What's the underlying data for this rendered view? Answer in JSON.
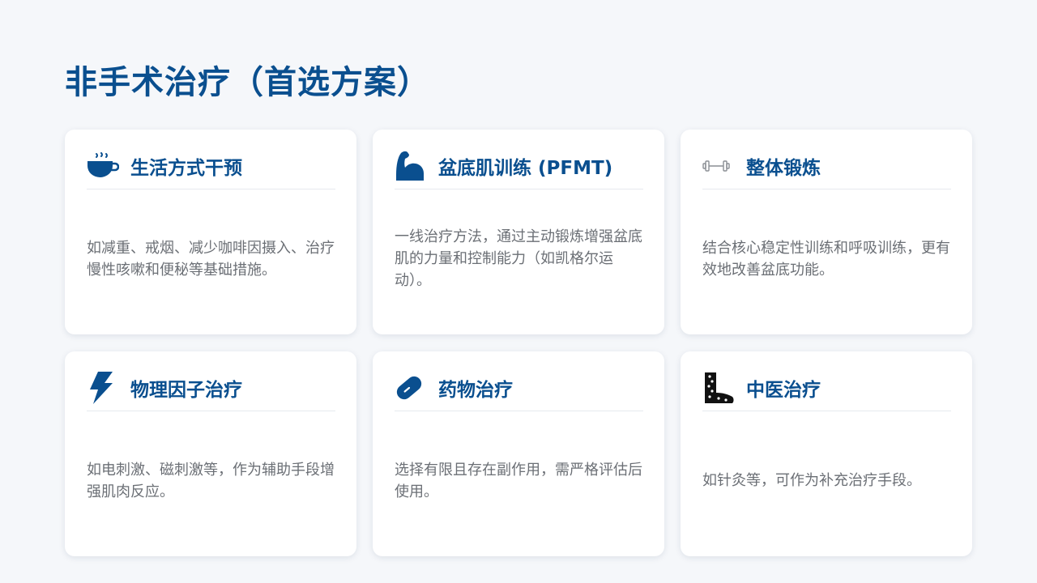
{
  "page": {
    "title": "非手术治疗（首选方案）"
  },
  "colors": {
    "accent": "#0a4f8f",
    "body_text": "#6b6f75",
    "background": "#f5f7fa",
    "card": "#ffffff"
  },
  "cards": [
    {
      "icon": "coffee-cup-icon",
      "title": "生活方式干预",
      "text": "如减重、戒烟、减少咖啡因摄入、治疗慢性咳嗽和便秘等基础措施。"
    },
    {
      "icon": "flexed-arm-icon",
      "title": "盆底肌训练 (PFMT)",
      "text": "一线治疗方法，通过主动锻炼增强盆底肌的力量和控制能力（如凯格尔运动）。"
    },
    {
      "icon": "dumbbell-icon",
      "title": "整体锻炼",
      "text": "结合核心稳定性训练和呼吸训练，更有效地改善盆底功能。"
    },
    {
      "icon": "lightning-bolt-icon",
      "title": "物理因子治疗",
      "text": "如电刺激、磁刺激等，作为辅助手段增强肌肉反应。"
    },
    {
      "icon": "pill-capsule-icon",
      "title": "药物治疗",
      "text": "选择有限且存在副作用，需严格评估后使用。"
    },
    {
      "icon": "acupuncture-foot-icon",
      "title": "中医治疗",
      "text": "如针灸等，可作为补充治疗手段。"
    }
  ]
}
